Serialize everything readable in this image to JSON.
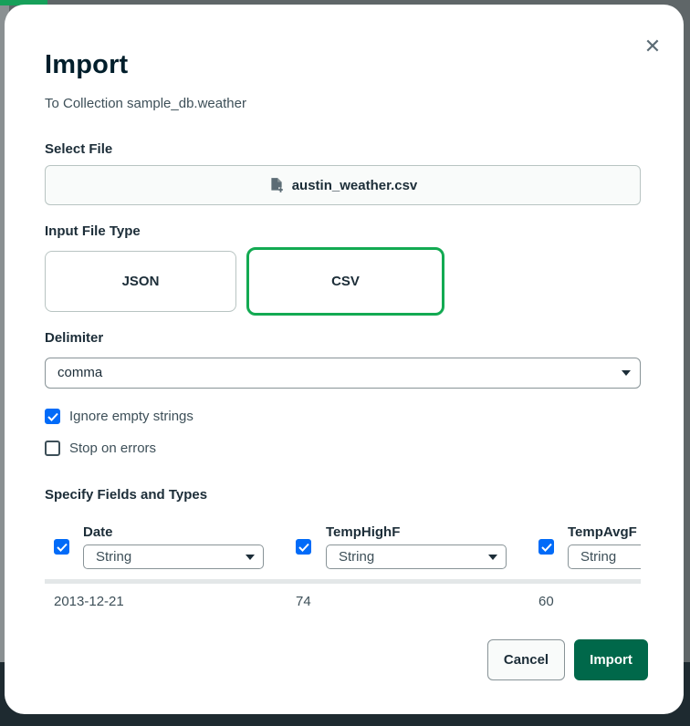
{
  "dialog": {
    "title": "Import",
    "subtitle": "To Collection sample_db.weather",
    "close_icon": "close-icon"
  },
  "select_file": {
    "label": "Select File",
    "file_name": "austin_weather.csv",
    "icon": "file-icon"
  },
  "input_file_type": {
    "label": "Input File Type",
    "options": [
      "JSON",
      "CSV"
    ],
    "selected": "CSV"
  },
  "delimiter": {
    "label": "Delimiter",
    "value": "comma"
  },
  "options": {
    "ignore_empty": {
      "label": "Ignore empty strings",
      "checked": true
    },
    "stop_on_errors": {
      "label": "Stop on errors",
      "checked": false
    }
  },
  "fields": {
    "label": "Specify Fields and Types",
    "columns": [
      {
        "name": "Date",
        "type": "String",
        "sample": "2013-12-21",
        "checked": true
      },
      {
        "name": "TempHighF",
        "type": "String",
        "sample": "74",
        "checked": true
      },
      {
        "name": "TempAvgF",
        "type": "String",
        "sample": "60",
        "checked": true
      }
    ]
  },
  "actions": {
    "cancel": "Cancel",
    "import": "Import"
  },
  "colors": {
    "accent_green": "#13aa52",
    "primary_button": "#00684a",
    "checkbox_blue": "#016bf8"
  }
}
